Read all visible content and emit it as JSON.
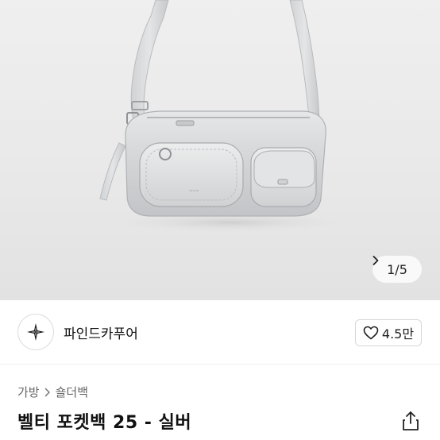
{
  "gallery": {
    "current": "1",
    "total": "5",
    "counter_text": "1/5"
  },
  "seller": {
    "name": "파인드카푸어",
    "likes": "4.5만"
  },
  "breadcrumb": [
    "가방",
    "숄더백"
  ],
  "product": {
    "title": "벨티 포켓백 25 - 실버"
  },
  "icons": {
    "seller_logo": "star-sparkle-logo",
    "like": "heart-icon",
    "next": "chevron-right-icon",
    "breadcrumb_sep": "chevron-right-icon",
    "share": "share-icon"
  },
  "colors": {
    "hero_bg": "#eaeaea",
    "bag_silver": "#d9dadb",
    "text_primary": "#111111",
    "text_secondary": "#666666"
  }
}
